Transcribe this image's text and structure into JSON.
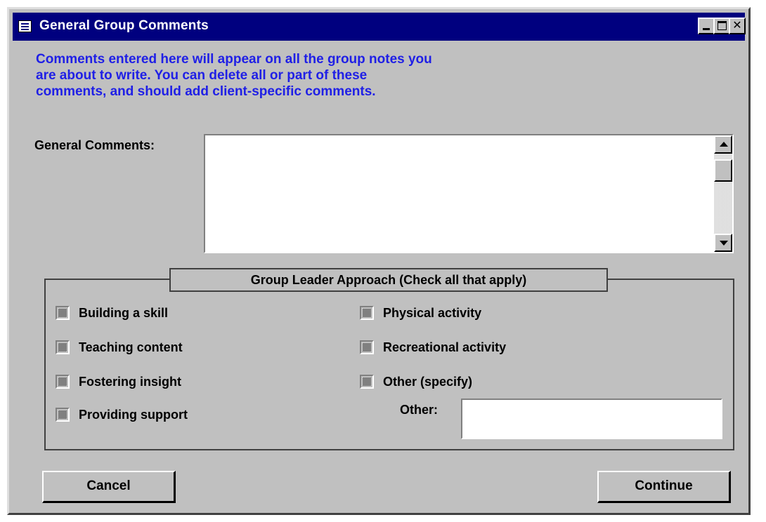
{
  "window": {
    "title": "General Group Comments",
    "icon": "form-icon",
    "controls": [
      "minimize",
      "maximize",
      "close"
    ]
  },
  "intro": {
    "lines": [
      "Comments entered here will appear on all the group notes you",
      "are about to write.  You can delete all or part of these",
      "comments, and should add client-specific comments."
    ],
    "color": "#1f1fe6"
  },
  "general_comments": {
    "label": "General Comments:",
    "value": ""
  },
  "group_leader": {
    "title": "Group Leader Approach (Check all that apply)",
    "left_options": [
      "Building a skill",
      "Teaching content",
      "Fostering insight",
      "Providing support"
    ],
    "right_options": [
      "Physical activity",
      "Recreational activity",
      "Other (specify)"
    ],
    "other_label": "Other:",
    "other_value": ""
  },
  "buttons": {
    "cancel": "Cancel",
    "continue": "Continue"
  },
  "colors": {
    "title_bar": "#00007f",
    "dialog_bg": "#c0c0c0"
  }
}
